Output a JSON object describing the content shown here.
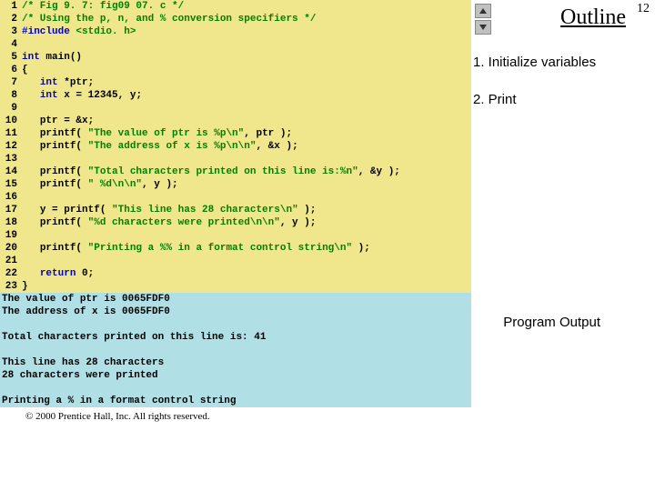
{
  "lineNumbers": [
    "1",
    "2",
    "3",
    "4",
    "5",
    "6",
    "7",
    "8",
    "9",
    "10",
    "11",
    "12",
    "13",
    "14",
    "15",
    "16",
    "17",
    "18",
    "19",
    "20",
    "21",
    "22",
    "23"
  ],
  "code": {
    "l1_comment": "/* Fig 9. 7: fig09 07. c */",
    "l2_comment": "/* Using the p, n, and % conversion specifiers */",
    "l3_pre": "#include",
    "l3_hdr": " <stdio. h>",
    "l5_kw": "int",
    "l5_rest": " main()",
    "l6": "{",
    "l7_ind": "   ",
    "l7_kw": "int",
    "l7_rest": " *ptr;",
    "l8_ind": "   ",
    "l8_kw": "int",
    "l8_rest": " x = 12345, y;",
    "l10_ind": "   ",
    "l10_rest": "ptr = &x;",
    "l11_ind": "   ",
    "l11_fn": "printf( ",
    "l11_str": "\"The value of ptr is %p\\n\"",
    "l11_end": ", ptr );",
    "l12_ind": "   ",
    "l12_fn": "printf( ",
    "l12_str": "\"The address of x is %p\\n\\n\"",
    "l12_end": ", &x );",
    "l14_ind": "   ",
    "l14_fn": "printf( ",
    "l14_str": "\"Total characters printed on this line is:%n\"",
    "l14_end": ", &y );",
    "l15_ind": "   ",
    "l15_fn": "printf( ",
    "l15_str": "\" %d\\n\\n\"",
    "l15_end": ", y );",
    "l17_ind": "   ",
    "l17_pre": "y = printf( ",
    "l17_str": "\"This line has 28 characters\\n\"",
    "l17_end": " );",
    "l18_ind": "   ",
    "l18_fn": "printf( ",
    "l18_str": "\"%d characters were printed\\n\\n\"",
    "l18_end": ", y );",
    "l20_ind": "   ",
    "l20_fn": "printf( ",
    "l20_str": "\"Printing a %% in a format control string\\n\"",
    "l20_end": " );",
    "l22_ind": "   ",
    "l22_kw": "return",
    "l22_rest": " 0;",
    "l23": "}"
  },
  "output": "The value of ptr is 0065FDF0\nThe address of x is 0065FDF0\n \nTotal characters printed on this line is: 41\n \nThis line has 28 characters\n28 characters were printed\n \nPrinting a % in a format control string",
  "footer": "© 2000 Prentice Hall, Inc.  All rights reserved.",
  "sidebar": {
    "title": "Outline",
    "pageNum": "12",
    "items": [
      "1. Initialize variables",
      "2. Print"
    ],
    "programOutput": "Program Output"
  }
}
